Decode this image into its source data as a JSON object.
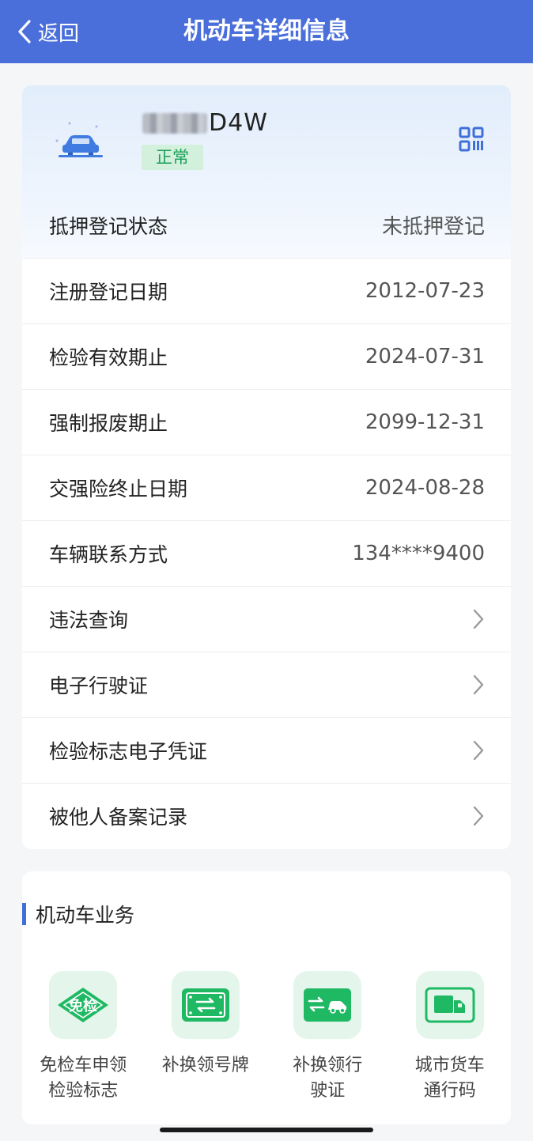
{
  "header": {
    "back_label": "返回",
    "title": "机动车详细信息"
  },
  "vehicle": {
    "plate_suffix": "D4W",
    "status": "正常"
  },
  "info_rows": [
    {
      "label": "抵押登记状态",
      "value": "未抵押登记"
    },
    {
      "label": "注册登记日期",
      "value": "2012-07-23"
    },
    {
      "label": "检验有效期止",
      "value": "2024-07-31"
    },
    {
      "label": "强制报废期止",
      "value": "2099-12-31"
    },
    {
      "label": "交强险终止日期",
      "value": "2024-08-28"
    },
    {
      "label": "车辆联系方式",
      "value": "134****9400"
    }
  ],
  "link_rows": [
    {
      "label": "违法查询"
    },
    {
      "label": "电子行驶证"
    },
    {
      "label": "检验标志电子凭证"
    },
    {
      "label": "被他人备案记录"
    }
  ],
  "business": {
    "title": "机动车业务",
    "services": [
      {
        "badge": "免检",
        "line1": "免检车申领",
        "line2": "检验标志",
        "icon": "inspection-exempt-icon"
      },
      {
        "line1": "补换领号牌",
        "line2": "",
        "icon": "license-plate-icon"
      },
      {
        "line1": "补换领行",
        "line2": "驶证",
        "icon": "driving-license-icon"
      },
      {
        "line1": "城市货车",
        "line2": "通行码",
        "icon": "truck-icon"
      }
    ]
  },
  "colors": {
    "header_bg": "#4a6fdb",
    "status_green": "#18a058",
    "service_green": "#1fb964",
    "accent_blue": "#3f6fd9"
  }
}
